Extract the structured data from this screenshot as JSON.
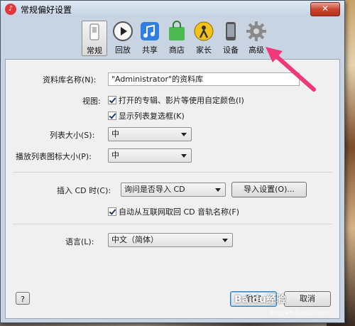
{
  "window": {
    "title": "常规偏好设置",
    "close_label": "✕",
    "app_icon": "itunes-icon"
  },
  "toolbar": {
    "items": [
      {
        "label": "常规",
        "icon": "general-switch-icon"
      },
      {
        "label": "回放",
        "icon": "play-icon"
      },
      {
        "label": "共享",
        "icon": "music-note-icon"
      },
      {
        "label": "商店",
        "icon": "shopping-bag-icon"
      },
      {
        "label": "家长",
        "icon": "parental-icon"
      },
      {
        "label": "设备",
        "icon": "device-icon"
      },
      {
        "label": "高级",
        "icon": "gear-icon"
      }
    ]
  },
  "general": {
    "library_name_label": "资料库名称(N):",
    "library_name_value": "\"Administrator\"的资料库",
    "view_label": "视图:",
    "view_option1": "打开的专辑、影片等使用自定颜色(I)",
    "view_option2": "显示列表复选框(K)",
    "list_size_label": "列表大小(S):",
    "list_size_value": "中",
    "icon_size_label": "播放列表图标大小(P):",
    "icon_size_value": "中",
    "cd_insert_label": "插入 CD 时(C):",
    "cd_insert_value": "询问是否导入 CD",
    "import_settings_button": "导入设置(O)...",
    "auto_fetch_label": "自动从互联网取回 CD 音轨名称(F)",
    "language_label": "语言(L):",
    "language_value": "中文（简体）"
  },
  "footer": {
    "help_label": "?",
    "ok_label": "确定",
    "cancel_label": "取消"
  },
  "overlay": {
    "watermark": "Baidu经验",
    "watermark_sub": "jingyan.baidu.com"
  },
  "colors": {
    "accent_arrow": "#f0387a",
    "panel_bg": "#f0f0f0",
    "frame_bg": "#c9d4e2"
  }
}
